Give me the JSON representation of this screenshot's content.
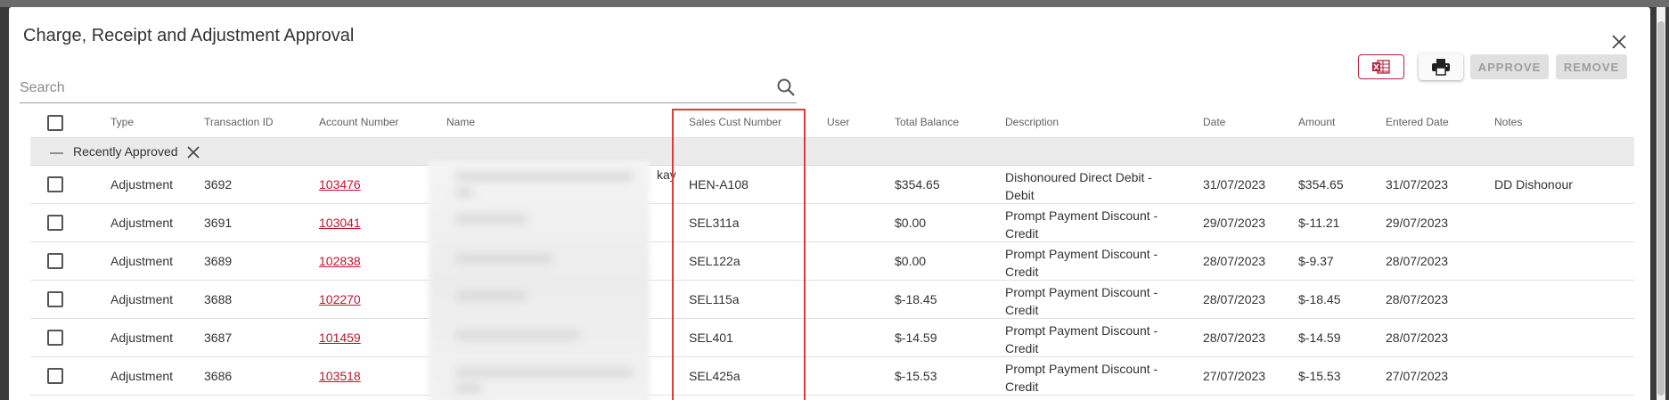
{
  "dialog": {
    "title": "Charge, Receipt and Adjustment Approval"
  },
  "search": {
    "placeholder": "Search",
    "value": ""
  },
  "toolbar": {
    "approve_label": "APPROVE",
    "remove_label": "REMOVE",
    "excel_icon": "excel-export-icon",
    "print_icon": "printer-icon"
  },
  "table": {
    "headers": {
      "type": "Type",
      "transaction_id": "Transaction ID",
      "account_number": "Account Number",
      "name": "Name",
      "sales_cust_number": "Sales Cust Number",
      "user": "User",
      "total_balance": "Total Balance",
      "description": "Description",
      "date": "Date",
      "amount": "Amount",
      "entered_date": "Entered Date",
      "notes": "Notes"
    },
    "group": {
      "label": "Recently Approved"
    },
    "rows": [
      {
        "type": "Adjustment",
        "transaction_id": "3692",
        "account_number": "103476",
        "name_fragment": "kay",
        "sales_cust_number": "HEN-A108",
        "total_balance": "$354.65",
        "description": "Dishonoured Direct Debit - Debit",
        "date": "31/07/2023",
        "amount": "$354.65",
        "entered_date": "31/07/2023",
        "notes": "DD Dishonour"
      },
      {
        "type": "Adjustment",
        "transaction_id": "3691",
        "account_number": "103041",
        "name_fragment": "",
        "sales_cust_number": "SEL311a",
        "total_balance": "$0.00",
        "description": "Prompt Payment Discount - Credit",
        "date": "29/07/2023",
        "amount": "$-11.21",
        "entered_date": "29/07/2023",
        "notes": ""
      },
      {
        "type": "Adjustment",
        "transaction_id": "3689",
        "account_number": "102838",
        "name_fragment": "",
        "sales_cust_number": "SEL122a",
        "total_balance": "$0.00",
        "description": "Prompt Payment Discount - Credit",
        "date": "28/07/2023",
        "amount": "$-9.37",
        "entered_date": "28/07/2023",
        "notes": ""
      },
      {
        "type": "Adjustment",
        "transaction_id": "3688",
        "account_number": "102270",
        "name_fragment": "",
        "sales_cust_number": "SEL115a",
        "total_balance": "$-18.45",
        "description": "Prompt Payment Discount - Credit",
        "date": "28/07/2023",
        "amount": "$-18.45",
        "entered_date": "28/07/2023",
        "notes": ""
      },
      {
        "type": "Adjustment",
        "transaction_id": "3687",
        "account_number": "101459",
        "name_fragment": "",
        "sales_cust_number": "SEL401",
        "total_balance": "$-14.59",
        "description": "Prompt Payment Discount - Credit",
        "date": "28/07/2023",
        "amount": "$-14.59",
        "entered_date": "28/07/2023",
        "notes": ""
      },
      {
        "type": "Adjustment",
        "transaction_id": "3686",
        "account_number": "103518",
        "name_fragment": "",
        "sales_cust_number": "SEL425a",
        "total_balance": "$-15.53",
        "description": "Prompt Payment Discount - Credit",
        "date": "27/07/2023",
        "amount": "$-15.53",
        "entered_date": "27/07/2023",
        "notes": ""
      }
    ]
  },
  "colors": {
    "link": "#c0152f",
    "highlight_border": "#e03a3a",
    "excel_border": "#b3203a"
  }
}
